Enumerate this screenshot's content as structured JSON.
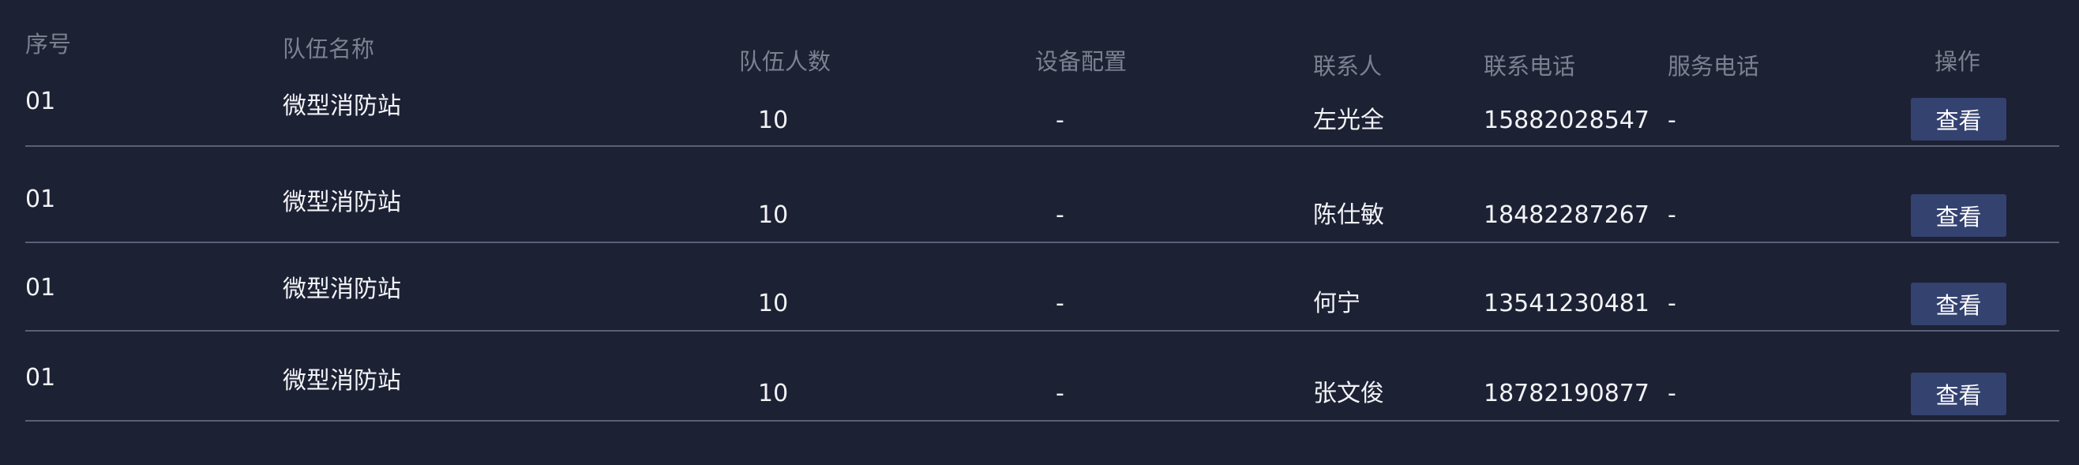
{
  "table": {
    "headers": {
      "index": "序号",
      "team_name": "队伍名称",
      "team_size": "队伍人数",
      "equipment": "设备配置",
      "contact": "联系人",
      "contact_phone": "联系电话",
      "service_phone": "服务电话",
      "actions": "操作"
    },
    "rows": [
      {
        "index": "01",
        "team_name": "微型消防站",
        "team_size": "10",
        "equipment": "-",
        "contact": "左光全",
        "contact_phone": "15882028547",
        "service_phone": "-",
        "action_label": "查看"
      },
      {
        "index": "01",
        "team_name": "微型消防站",
        "team_size": "10",
        "equipment": "-",
        "contact": "陈仕敏",
        "contact_phone": "18482287267",
        "service_phone": "-",
        "action_label": "查看"
      },
      {
        "index": "01",
        "team_name": "微型消防站",
        "team_size": "10",
        "equipment": "-",
        "contact": "何宁",
        "contact_phone": "13541230481",
        "service_phone": "-",
        "action_label": "查看"
      },
      {
        "index": "01",
        "team_name": "微型消防站",
        "team_size": "10",
        "equipment": "-",
        "contact": "张文俊",
        "contact_phone": "18782190877",
        "service_phone": "-",
        "action_label": "查看"
      }
    ]
  },
  "colors": {
    "background": "#1c2134",
    "header_text": "#7c8190",
    "cell_text": "#f2f3f6",
    "divider": "#5a6076",
    "button_bg": "#344270"
  }
}
